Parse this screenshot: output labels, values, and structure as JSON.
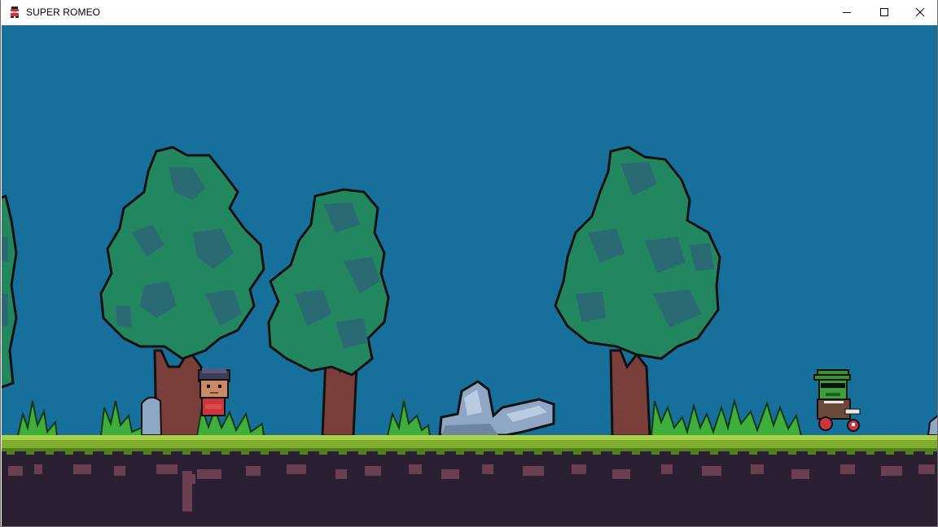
{
  "window": {
    "title": "SUPER ROMEO",
    "controls": {
      "minimize": "minimize-icon",
      "maximize": "maximize-icon",
      "close": "close-icon"
    }
  },
  "scene": {
    "sky_color": "#176f9c",
    "grass_color": "#7fae2f",
    "grass_dark": "#4f7f1f",
    "soil_color": "#2a2032",
    "soil_spot_color": "#6b3f52",
    "tree_foliage": "#22875f",
    "tree_foliage_shade": "#2a6b73",
    "tree_trunk": "#7a3f3a",
    "rock_color": "#8fa7c4",
    "player": "romeo-player",
    "enemy": "green-goblin-with-sunglasses"
  }
}
